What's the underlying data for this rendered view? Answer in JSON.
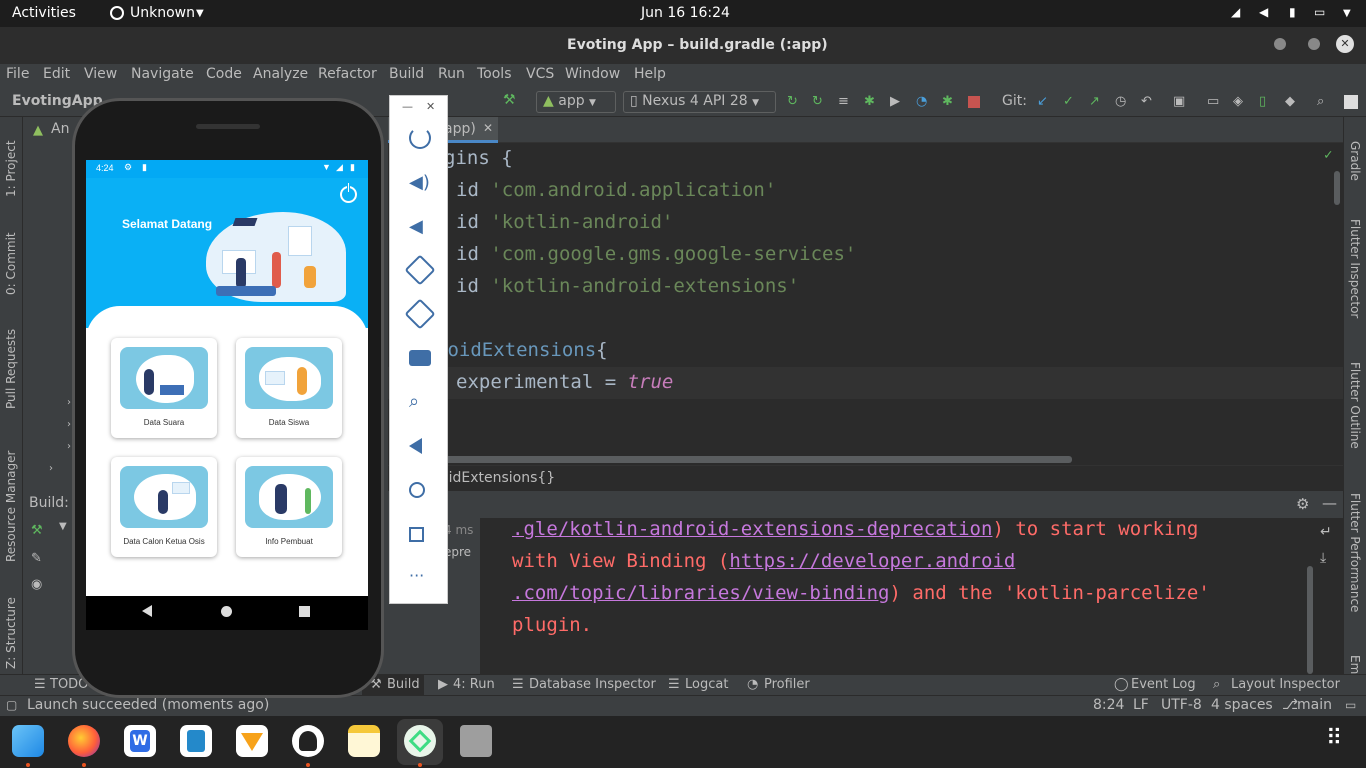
{
  "topbar": {
    "activities": "Activities",
    "app": "Unknown",
    "clock": "Jun 16  16:24"
  },
  "window": {
    "title": "Evoting App – build.gradle (:app)"
  },
  "menu": [
    "File",
    "Edit",
    "View",
    "Navigate",
    "Code",
    "Analyze",
    "Refactor",
    "Build",
    "Run",
    "Tools",
    "VCS",
    "Window",
    "Help"
  ],
  "toolbar": {
    "project": "EvotingApp",
    "run_config": "app",
    "device": "Nexus 4 API 28",
    "git": "Git:"
  },
  "left_tabs": [
    "1: Project",
    "0: Commit",
    "Pull Requests",
    "Resource Manager",
    "Z: Structure"
  ],
  "right_tabs": [
    "Gradle",
    "Flutter Inspector",
    "Flutter Outline",
    "Flutter Performance",
    "Em"
  ],
  "project_panel": {
    "tab_partial": "An"
  },
  "build_panel": {
    "title": "Build:",
    "time_partial": "4 ms",
    "text_partial": "epre"
  },
  "editor": {
    "tab_label": "app)",
    "lines": [
      {
        "a": "gins ",
        "b": "{"
      },
      {
        "a": "id ",
        "b": "'com.android.application'"
      },
      {
        "a": "id ",
        "b": "'kotlin-android'"
      },
      {
        "a": "id ",
        "b": "'com.google.gms.google-services'"
      },
      {
        "a": "id ",
        "b": "'kotlin-android-extensions'"
      },
      {
        "a": "roidExtensions",
        "b": "{"
      },
      {
        "a": "experimental = ",
        "b": "true"
      }
    ],
    "breadcrumb": "oidExtensions{}"
  },
  "console": {
    "l1_link": ".gle/kotlin-android-extensions-deprecation",
    "l1_rest": ") to start working",
    "l2_text": "with View Binding (",
    "l2_link": "https://developer.android",
    "l3_link": ".com/topic/libraries/view-binding",
    "l3_rest": ") and the 'kotlin-parcelize'",
    "l4": "plugin."
  },
  "tool_tabs": {
    "todo": "TODO",
    "build": "Build",
    "run": "4: Run",
    "db": "Database Inspector",
    "logcat": "Logcat",
    "profiler": "Profiler",
    "event_log": "Event Log",
    "layout_inspector": "Layout Inspector"
  },
  "status": {
    "message": "Launch succeeded (moments ago)",
    "position": "8:24",
    "line_sep": "LF",
    "encoding": "UTF-8",
    "indent": "4 spaces",
    "branch": "main"
  },
  "phone": {
    "time": "4:24",
    "greeting": "Selamat Datang",
    "menu_items": [
      "Data Suara",
      "Data Siswa",
      "Data Calon Ketua Osis",
      "Info Pembuat"
    ]
  },
  "colors": {
    "ide_bg": "#2b2b2b",
    "ide_panel": "#3c3f41",
    "app_header": "#03a9f4",
    "string": "#6a8759",
    "keyword": "#cc7832",
    "console_error": "#ff6b68"
  }
}
